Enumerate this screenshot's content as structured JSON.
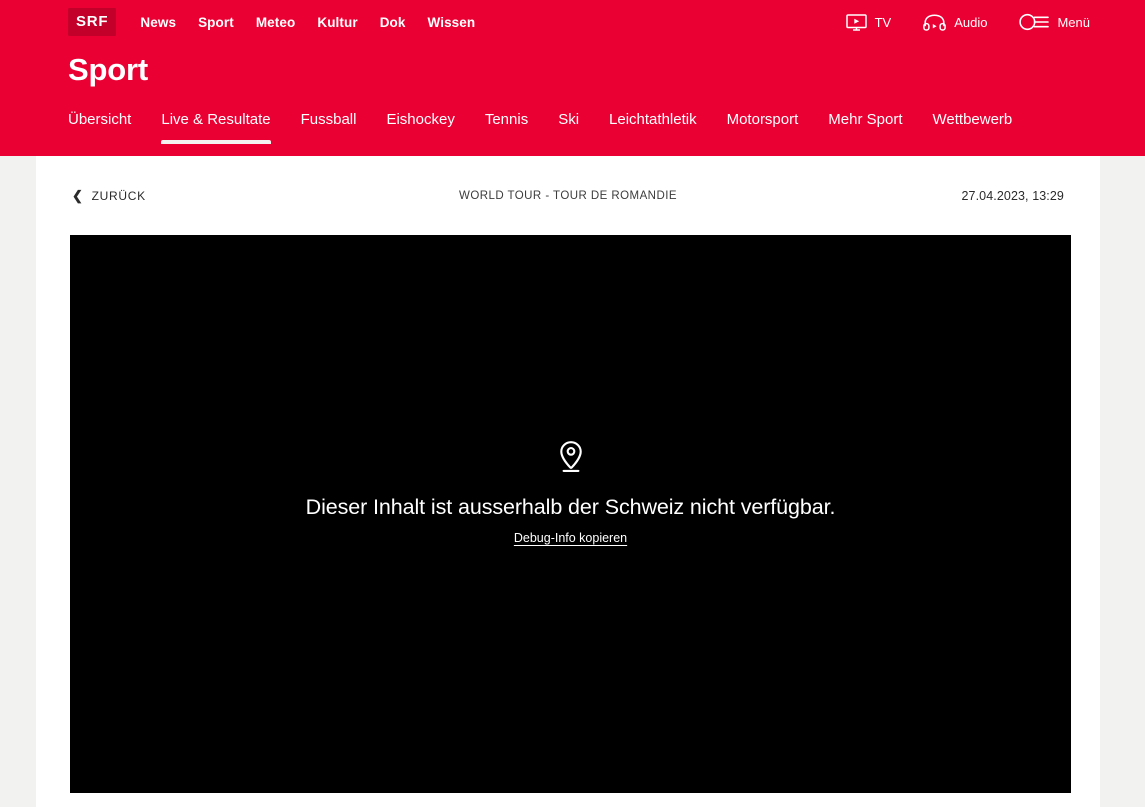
{
  "header": {
    "brand": "SRF",
    "brand_bg": "#c2002a",
    "accent": "#eb0033",
    "main_nav": [
      {
        "label": "News"
      },
      {
        "label": "Sport"
      },
      {
        "label": "Meteo"
      },
      {
        "label": "Kultur"
      },
      {
        "label": "Dok"
      },
      {
        "label": "Wissen"
      }
    ],
    "actions": [
      {
        "label": "TV",
        "icon": "tv-icon"
      },
      {
        "label": "Audio",
        "icon": "headphones-icon"
      },
      {
        "label": "Menü",
        "icon": "search-menu-icon"
      }
    ]
  },
  "page": {
    "title": "Sport"
  },
  "section_nav": {
    "items": [
      {
        "label": "Übersicht",
        "active": false
      },
      {
        "label": "Live & Resultate",
        "active": true
      },
      {
        "label": "Fussball",
        "active": false
      },
      {
        "label": "Eishockey",
        "active": false
      },
      {
        "label": "Tennis",
        "active": false
      },
      {
        "label": "Ski",
        "active": false
      },
      {
        "label": "Leichtathletik",
        "active": false
      },
      {
        "label": "Motorsport",
        "active": false
      },
      {
        "label": "Mehr Sport",
        "active": false
      },
      {
        "label": "Wettbewerb",
        "active": false
      }
    ]
  },
  "content": {
    "back_label": "ZURÜCK",
    "back_chevron": "❮",
    "event_title": "WORLD TOUR - TOUR DE ROMANDIE",
    "timestamp": "27.04.2023, 13:29"
  },
  "player": {
    "icon": "location-pin-icon",
    "message": "Dieser Inhalt ist ausserhalb der Schweiz nicht verfügbar.",
    "debug_link": "Debug-Info kopieren",
    "background": "#000000"
  }
}
